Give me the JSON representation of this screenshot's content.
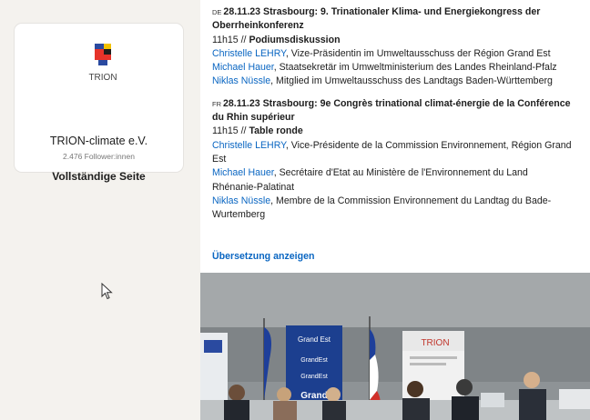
{
  "company_card": {
    "logo_text": "TRION",
    "name": "TRION-climate e.V.",
    "followers": "2.476 Follower:innen",
    "full_page_label": "Vollständige Seite"
  },
  "post": {
    "de": {
      "flag": "DE",
      "date": "28.11.23",
      "title_1": "Strasbourg: 9. Trinationaler Klima- und Energiekongress der",
      "title_2": "Oberrheinkonferenz",
      "time": "11h15 //",
      "session": "Podiumsdiskussion",
      "people": [
        {
          "name": "Christelle LEHRY",
          "role": ", Vize-Präsidentin im Umweltausschuss der Région Grand Est"
        },
        {
          "name": "Michael Hauer",
          "role": ", Staatsekretär im Umweltministerium des Landes Rheinland-Pfalz"
        },
        {
          "name": "Niklas Nüssle",
          "role": ", Mitglied im Umweltausschuss des Landtags Baden-Württemberg"
        }
      ]
    },
    "fr": {
      "flag": "FR",
      "date": "28.11.23",
      "title_1": "Strasbourg: 9e Congrès trinational climat-énergie de la Conférence",
      "title_2": "du Rhin supérieur",
      "time": "11h15 //",
      "session": "Table ronde",
      "p1_name": "Christelle LEHRY",
      "p1_role_a": ", Vice-Présidente de la Commission Environnement, Région Grand",
      "p1_role_b": "Est",
      "p2_name": "Michael Hauer",
      "p2_role_a": ", Secrétaire d'Etat au Ministère de l'Environnement du Land",
      "p2_role_b": "Rhénanie-Palatinat",
      "p3_name": "Niklas Nüssle",
      "p3_role_a": ", Membre de la Commission Environnement du Landtag du Bade-",
      "p3_role_b": "Wurtemberg"
    },
    "translate_label": "Übersetzung anzeigen",
    "photo": {
      "banner_left": "Grand Est",
      "banner_left_2": "GrandEst",
      "banner_left_3": "GrandEst",
      "banner_center": "Grand",
      "poster_right": "TRION"
    }
  },
  "colors": {
    "link": "#0a66c2",
    "page_bg": "#f4f2ee",
    "card_bg": "#ffffff"
  }
}
